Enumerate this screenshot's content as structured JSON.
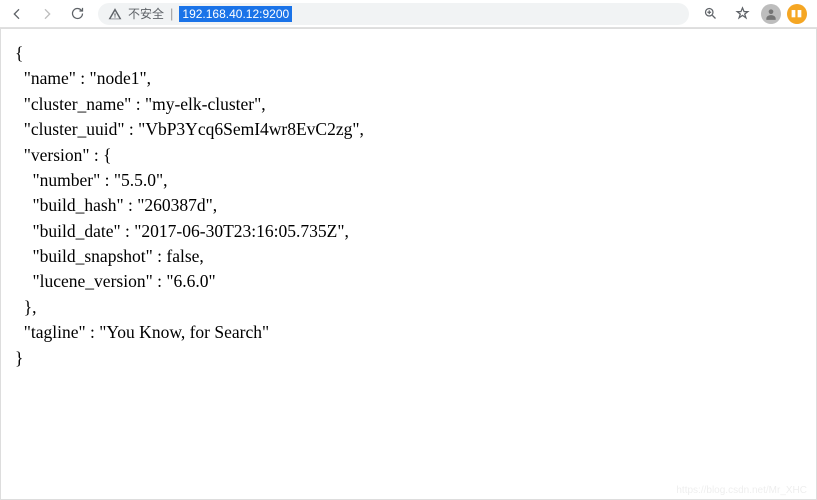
{
  "toolbar": {
    "security_label": "不安全",
    "url": "192.168.40.12:9200"
  },
  "json_response": {
    "name": "node1",
    "cluster_name": "my-elk-cluster",
    "cluster_uuid": "VbP3Ycq6SemI4wr8EvC2zg",
    "version": {
      "number": "5.5.0",
      "build_hash": "260387d",
      "build_date": "2017-06-30T23:16:05.735Z",
      "build_snapshot": false,
      "lucene_version": "6.6.0"
    },
    "tagline": "You Know, for Search"
  },
  "watermark": "https://blog.csdn.net/Mr_XHC"
}
